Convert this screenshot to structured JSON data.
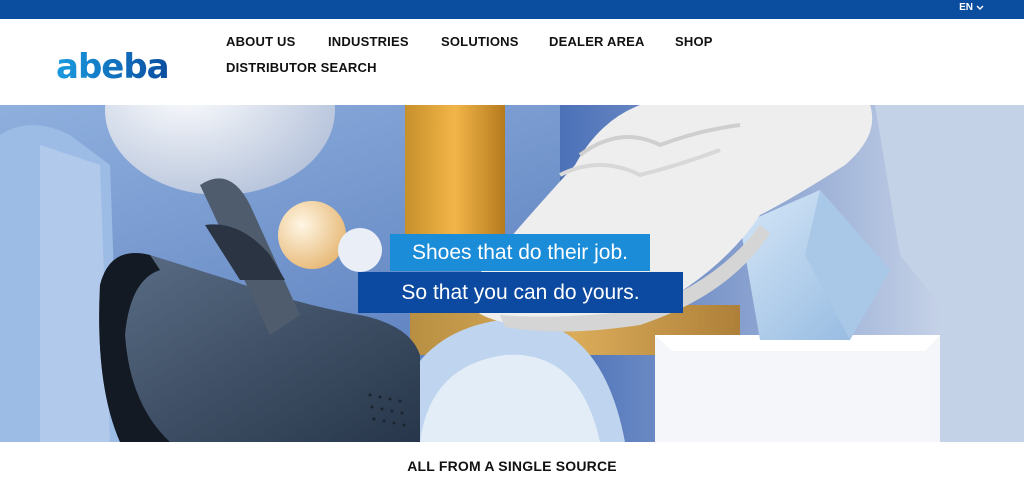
{
  "topbar": {
    "language": "EN"
  },
  "brand": {
    "logo_text": "abeba"
  },
  "nav": {
    "items": [
      {
        "label": "ABOUT US"
      },
      {
        "label": "INDUSTRIES"
      },
      {
        "label": "SOLUTIONS"
      },
      {
        "label": "DEALER AREA"
      },
      {
        "label": "SHOP"
      },
      {
        "label": "DISTRIBUTOR SEARCH"
      }
    ]
  },
  "hero": {
    "headline": "Shoes that do their job.",
    "subheadline": "So that you can do yours."
  },
  "section": {
    "title": "ALL FROM A SINGLE SOURCE"
  },
  "colors": {
    "brand_blue": "#0b4d9f",
    "accent_blue": "#1b8cd8"
  }
}
